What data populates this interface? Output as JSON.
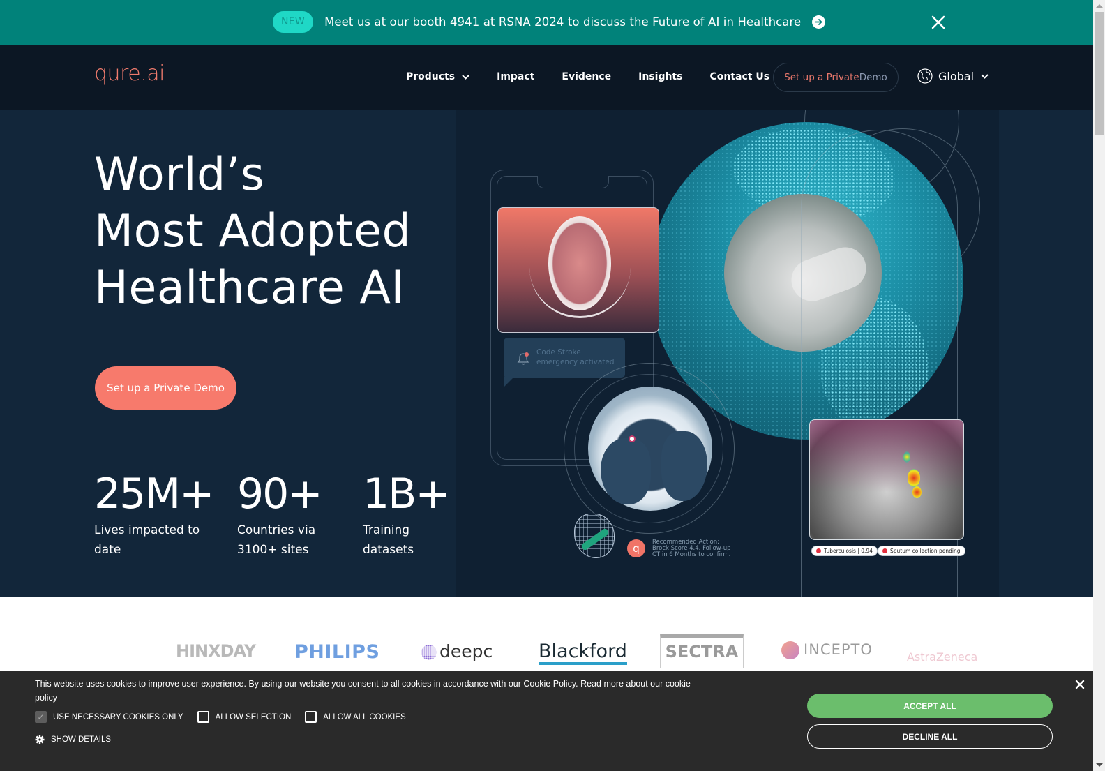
{
  "announcement": {
    "badge": "NEW",
    "text": "Meet us at our booth 4941 at RSNA 2024 to discuss the Future of AI in Healthcare",
    "arrow_icon": "arrow-right-circle-icon",
    "close_icon": "close-icon",
    "bg_color": "#01827a"
  },
  "nav": {
    "logo": "qure.ai",
    "links": [
      {
        "label": "Products",
        "has_dropdown": true
      },
      {
        "label": "Impact"
      },
      {
        "label": "Evidence"
      },
      {
        "label": "Insights"
      },
      {
        "label": "Contact Us"
      }
    ],
    "demo_button": {
      "part1": "Set up a Private ",
      "part2": "Demo"
    },
    "region": {
      "label": "Global",
      "icon": "globe-icon"
    }
  },
  "hero": {
    "title_lines": [
      "World’s",
      "Most Adopted",
      "Healthcare AI"
    ],
    "cta": "Set up a Private Demo",
    "stats": [
      {
        "value": "25M+",
        "label_lines": [
          "Lives impacted  to",
          "date"
        ]
      },
      {
        "value": "90+",
        "label_lines": [
          "Countries via",
          "3100+ sites"
        ]
      },
      {
        "value": "1B+",
        "label_lines": [
          "Training",
          "datasets"
        ]
      }
    ],
    "art": {
      "alert_text": "Code Stroke emergency activated",
      "q_badge": "q",
      "recommendation_lines": [
        "Recommended Action:",
        "Brock Score 4.4. Follow-up",
        "CT in 6 Months to confirm."
      ],
      "pills": [
        "Tuberculosis | 0.94",
        "Sputum collection pending"
      ]
    }
  },
  "partners": {
    "logos": [
      "",
      "HINXDAY",
      "PHILIPS",
      "deepc",
      "Blackford",
      "SECTRA",
      "INCEPTO",
      "AstraZeneca"
    ]
  },
  "cookie_banner": {
    "text": "This website uses cookies to improve user experience. By using our website you consent to all cookies in accordance with our Cookie Policy. Read more about our cookie policy",
    "options": [
      {
        "label": "USE NECESSARY COOKIES ONLY",
        "checked": true
      },
      {
        "label": "ALLOW SELECTION",
        "checked": false
      },
      {
        "label": "ALLOW ALL COOKIES",
        "checked": false
      }
    ],
    "show_details": "SHOW DETAILS",
    "accept": "ACCEPT ALL",
    "decline": "DECLINE ALL",
    "accept_color": "#6bbe6c"
  }
}
